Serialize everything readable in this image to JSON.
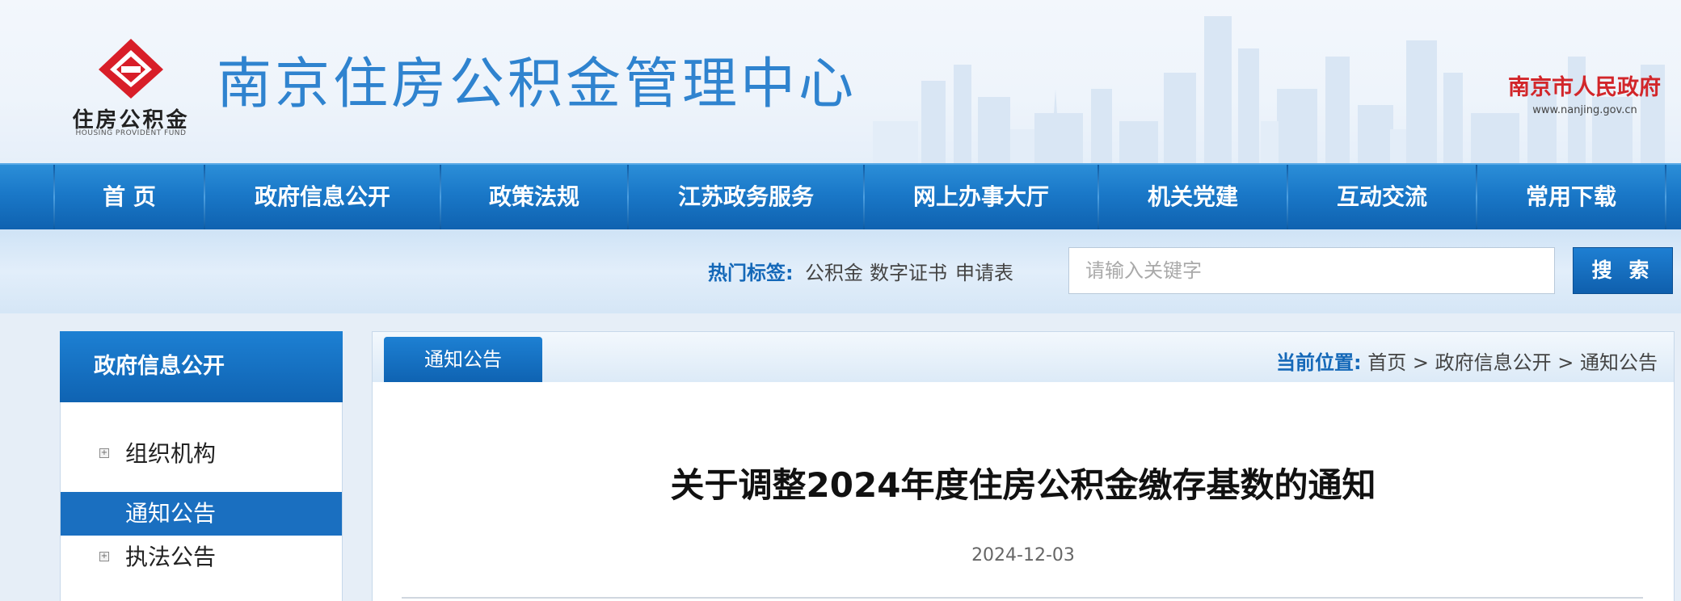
{
  "header": {
    "logo_cn": "住房公积金",
    "logo_en": "HOUSING PROVIDENT FUND",
    "site_title": "南京住房公积金管理中心",
    "gov_name": "南京市人民政府",
    "gov_url": "www.nanjing.gov.cn"
  },
  "nav": {
    "items": [
      "首 页",
      "政府信息公开",
      "政策法规",
      "江苏政务服务",
      "网上办事大厅",
      "机关党建",
      "互动交流",
      "常用下载"
    ]
  },
  "search": {
    "hot_label": "热门标签:",
    "tags": [
      "公积金",
      "数字证书",
      "申请表"
    ],
    "placeholder": "请输入关键字",
    "button_label": "搜 索"
  },
  "sidebar": {
    "title": "政府信息公开",
    "items": [
      {
        "label": "组织机构",
        "active": false
      },
      {
        "label": "通知公告",
        "active": true
      },
      {
        "label": "执法公告",
        "active": false
      }
    ]
  },
  "content": {
    "tab_label": "通知公告",
    "breadcrumb_label": "当前位置:",
    "breadcrumb": [
      "首页",
      "政府信息公开",
      "通知公告"
    ],
    "breadcrumb_sep": ">",
    "title": "关于调整2024年度住房公积金缴存基数的通知",
    "date": "2024-12-03"
  },
  "colors": {
    "brand_blue": "#1a78c8",
    "title_blue": "#2f83cf",
    "gov_red": "#d2262a",
    "logo_red": "#d81e28"
  }
}
